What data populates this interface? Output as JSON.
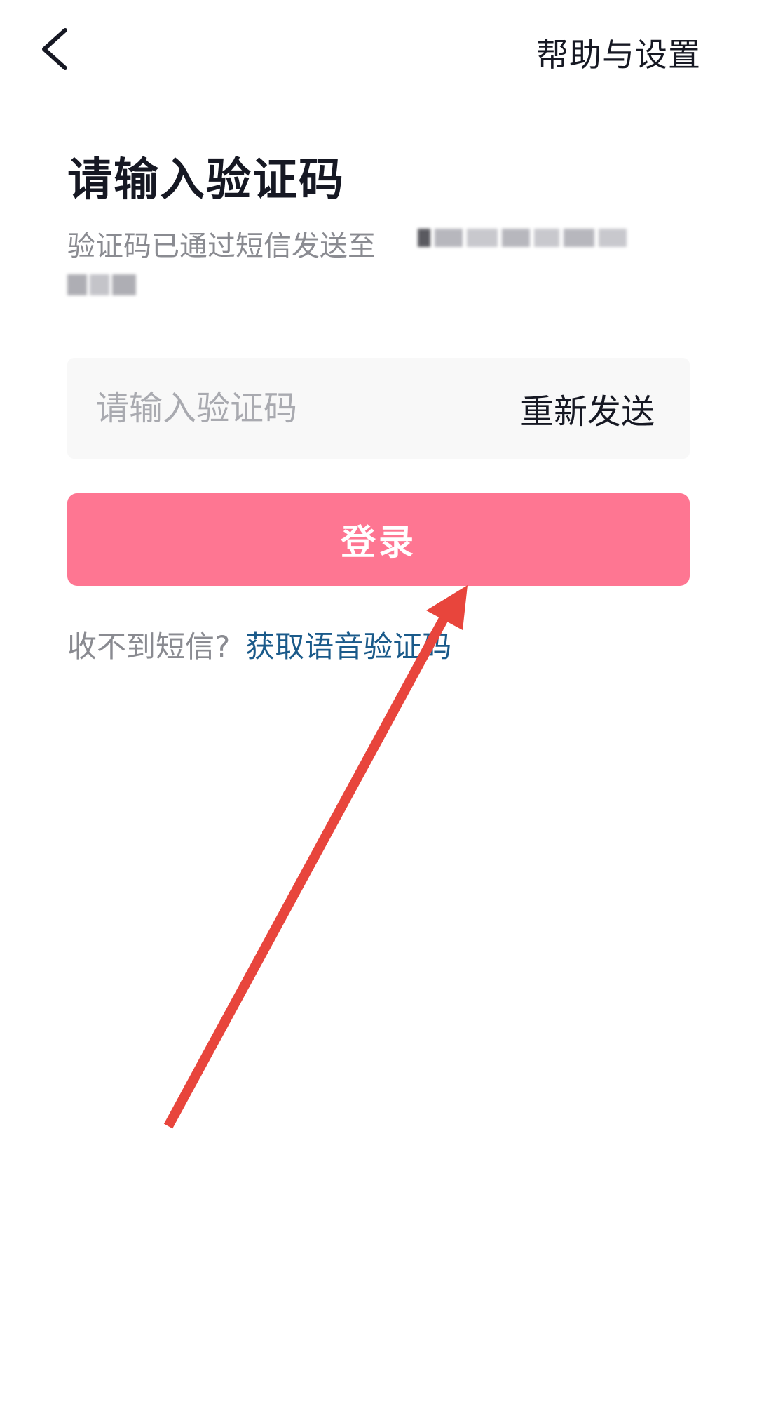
{
  "header": {
    "back_icon": "chevron-left-icon",
    "help_label": "帮助与设置"
  },
  "main": {
    "title": "请输入验证码",
    "subtitle": "验证码已通过短信发送至",
    "code_field": {
      "placeholder": "请输入验证码",
      "value": "",
      "resend_label": "重新发送"
    },
    "login_label": "登录",
    "no_sms_label": "收不到短信?",
    "voice_code_label": "获取语音验证码"
  },
  "colors": {
    "login_button": "#fe7692",
    "voice_link": "#1a5a8a",
    "annotation_arrow": "#e8453c"
  }
}
